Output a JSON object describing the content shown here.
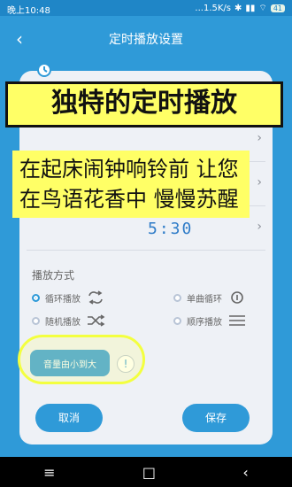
{
  "status_bar": {
    "time": "晚上10:48",
    "network": "...1.5K/s",
    "icons": [
      "bluetooth-icon",
      "signal-icon",
      "wifi-icon"
    ],
    "battery": "41"
  },
  "header": {
    "title": "定时播放设置"
  },
  "card": {
    "time_value": "5:30",
    "play_mode_section": "播放方式",
    "play_mode_options": [
      {
        "label": "循环播放",
        "selected": true,
        "icon": "repeat-icon"
      },
      {
        "label": "单曲循环",
        "selected": false,
        "icon": "repeat-one-icon"
      },
      {
        "label": "随机播放",
        "selected": false,
        "icon": "shuffle-icon"
      },
      {
        "label": "顺序播放",
        "selected": false,
        "icon": "list-order-icon"
      }
    ],
    "volume_label": "音量由小到大",
    "info_label": "!"
  },
  "actions": {
    "cancel": "取消",
    "save": "保存"
  },
  "overlays": {
    "title": "独特的定时播放",
    "text": "在起床闹钟响铃前 让您在鸟语花香中 慢慢苏醒"
  },
  "nav_bar": {
    "menu_icon": "menu-icon",
    "home_icon": "home-icon",
    "back_icon": "back-icon"
  },
  "colors": {
    "primary": "#2f9ad8",
    "card_bg": "#eef1f6",
    "overlay_yellow": "#ffff66"
  }
}
